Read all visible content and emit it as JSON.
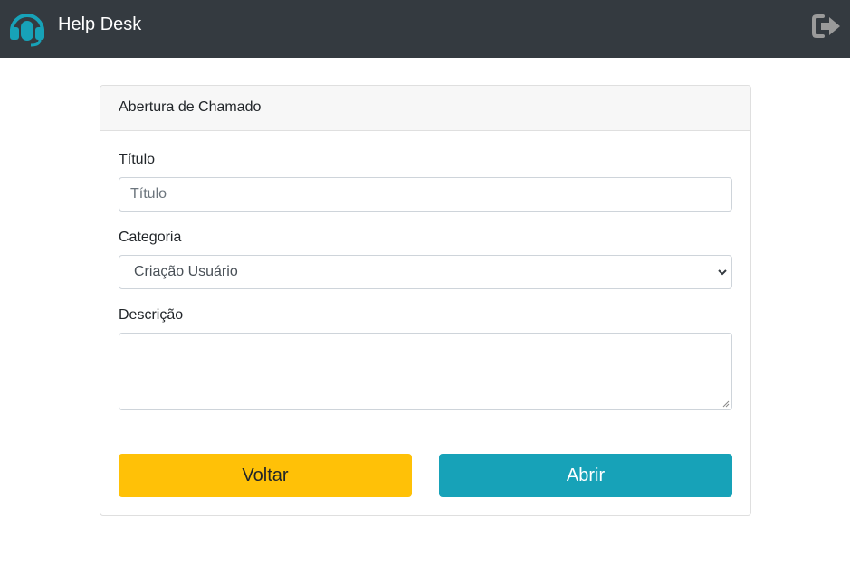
{
  "navbar": {
    "brand_title": "Help Desk",
    "logo_icon": "headset-icon",
    "logout_icon": "sign-out-icon",
    "brand_color": "#17a2b8"
  },
  "card": {
    "header": "Abertura de Chamado",
    "fields": {
      "titulo_label": "Título",
      "titulo_placeholder": "Título",
      "categoria_label": "Categoria",
      "categoria_selected": "Criação Usuário",
      "descricao_label": "Descrição",
      "descricao_value": ""
    },
    "buttons": {
      "back_label": "Voltar",
      "submit_label": "Abrir"
    }
  }
}
